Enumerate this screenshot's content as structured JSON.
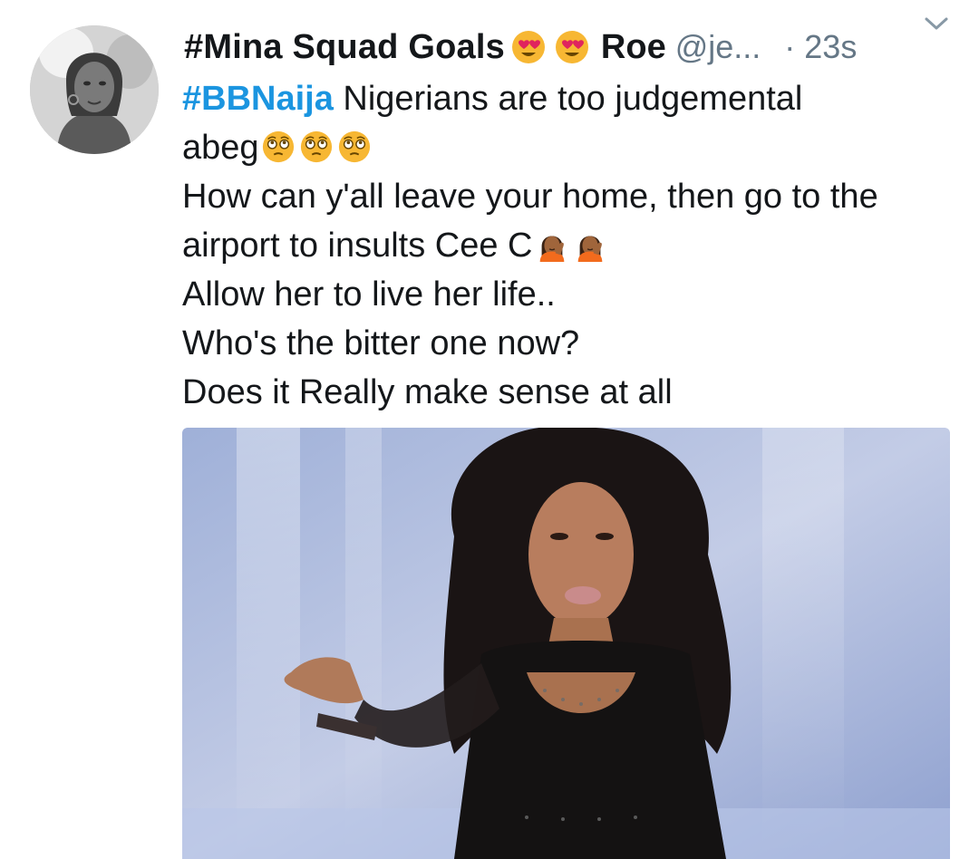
{
  "tweet": {
    "display_name": "#Mina Squad Goals",
    "name_suffix": "Roe",
    "handle": "@je...",
    "timestamp": "· 23s",
    "hashtag": "#BBNaija",
    "line1_rest": " Nigerians are too judgemental",
    "line2": "abeg",
    "line3": "How can y'all leave your home, then go to the",
    "line4": "airport to insults Cee C",
    "line5": "Allow her to live her life..",
    "line6": "Who's the bitter one now?",
    "line7": "Does it Really make sense at all",
    "header_emojis": [
      "heart-eyes-emoji",
      "heart-eyes-emoji"
    ],
    "abeg_emojis": [
      "flushed-face-emoji",
      "flushed-face-emoji",
      "flushed-face-emoji"
    ],
    "ceec_emojis": [
      "face-palm-emoji",
      "face-palm-emoji"
    ]
  },
  "colors": {
    "hashtag": "#1b95e0",
    "meta": "#657786",
    "text": "#14171a"
  }
}
